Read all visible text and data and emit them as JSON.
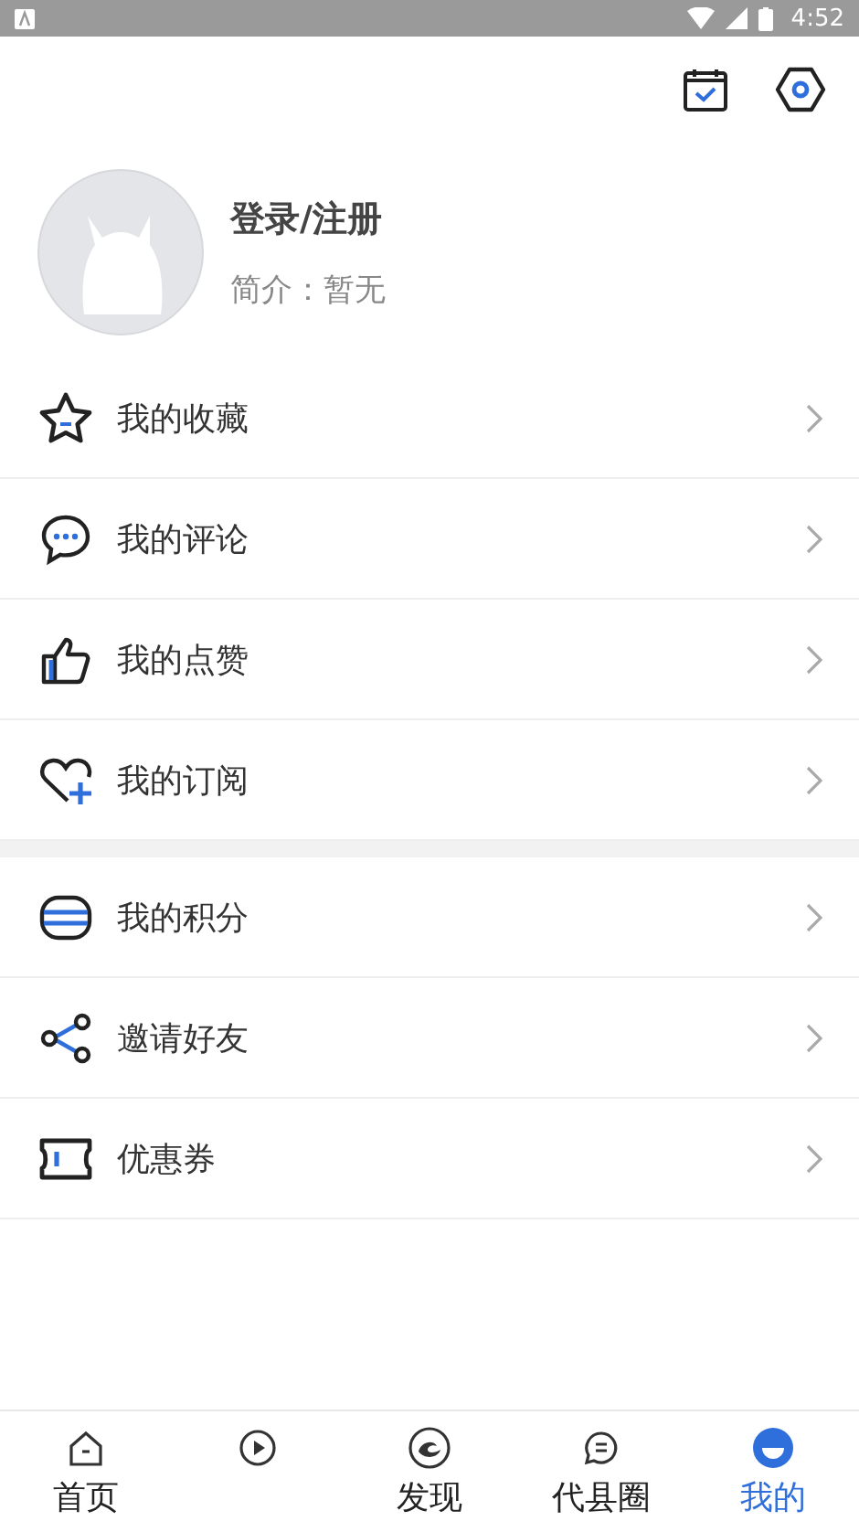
{
  "status_bar": {
    "time": "4:52"
  },
  "profile": {
    "name": "登录/注册",
    "bio": "简介：暂无"
  },
  "sections": [
    [
      {
        "label": "我的收藏"
      },
      {
        "label": "我的评论"
      },
      {
        "label": "我的点赞"
      },
      {
        "label": "我的订阅"
      }
    ],
    [
      {
        "label": "我的积分"
      },
      {
        "label": "邀请好友"
      },
      {
        "label": "优惠券"
      }
    ]
  ],
  "tabs": [
    {
      "label": "首页",
      "selected": false
    },
    {
      "selected": false
    },
    {
      "label": "发现",
      "selected": false
    },
    {
      "label": "代县圈",
      "selected": false
    },
    {
      "label": "我的",
      "selected": true
    }
  ]
}
